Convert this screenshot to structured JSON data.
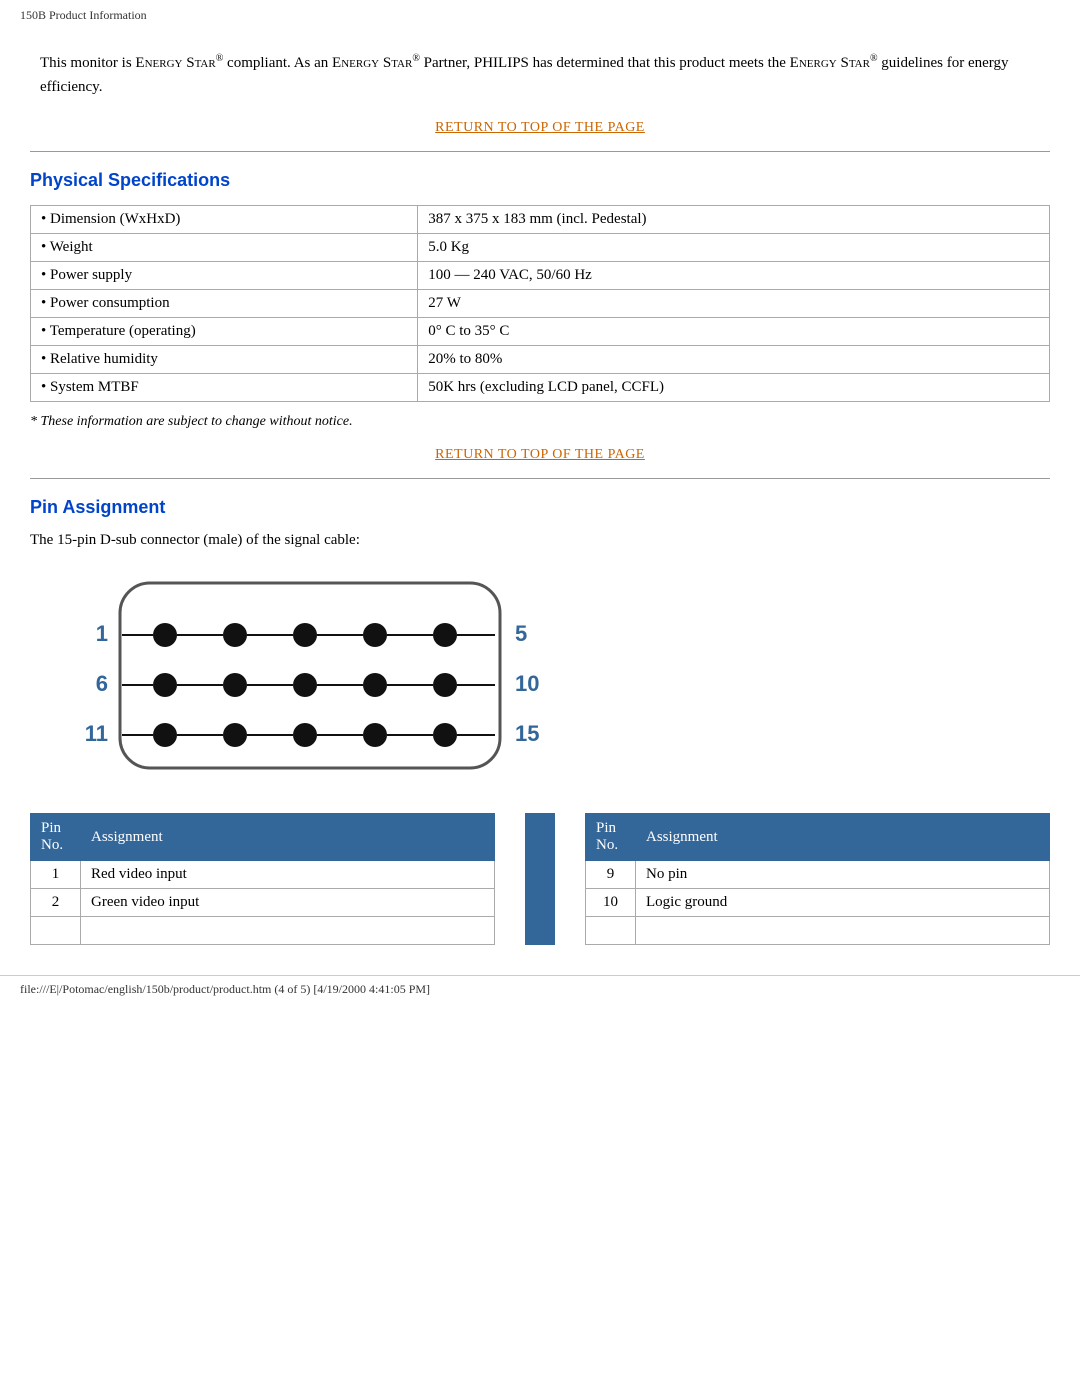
{
  "header": {
    "title": "150B Product Information"
  },
  "energy_star": {
    "text1": "This monitor is ",
    "brand1": "Energy Star",
    "reg1": "®",
    "text2": " compliant. As an ",
    "brand2": "Energy Star",
    "reg2": "®",
    "text3": " Partner, PHILIPS has determined that this product meets the ",
    "brand3": "Energy Star",
    "reg3": "®",
    "text4": " guidelines for energy efficiency."
  },
  "return_link": {
    "label": "RETURN TO TOP OF THE PAGE"
  },
  "physical_specs": {
    "section_title": "Physical Specifications",
    "rows": [
      {
        "label": "• Dimension (WxHxD)",
        "value": "387 x 375 x 183 mm (incl. Pedestal)"
      },
      {
        "label": "• Weight",
        "value": "5.0 Kg"
      },
      {
        "label": "• Power supply",
        "value": "100 — 240 VAC, 50/60 Hz"
      },
      {
        "label": "• Power consumption",
        "value": "27 W"
      },
      {
        "label": "• Temperature (operating)",
        "value": "0° C to 35° C"
      },
      {
        "label": "• Relative humidity",
        "value": "20% to 80%"
      },
      {
        "label": "• System MTBF",
        "value": "50K hrs (excluding LCD panel, CCFL)"
      }
    ],
    "footnote": "* These information are subject to change without notice."
  },
  "pin_assignment": {
    "section_title": "Pin Assignment",
    "description": "The 15-pin D-sub connector (male) of the signal cable:",
    "connector": {
      "row1_start": "1",
      "row1_end": "5",
      "row2_start": "6",
      "row2_end": "10",
      "row3_start": "11",
      "row3_end": "15"
    },
    "table_left": {
      "headers": [
        "Pin No.",
        "Assignment"
      ],
      "rows": [
        {
          "pin": "1",
          "assignment": "Red video input"
        },
        {
          "pin": "2",
          "assignment": "Green video input"
        }
      ]
    },
    "table_right": {
      "headers": [
        "Pin No.",
        "Assignment"
      ],
      "rows": [
        {
          "pin": "9",
          "assignment": "No pin"
        },
        {
          "pin": "10",
          "assignment": "Logic ground"
        }
      ]
    }
  },
  "footer": {
    "text": "file:///E|/Potomac/english/150b/product/product.htm (4 of 5) [4/19/2000 4:41:05 PM]"
  }
}
